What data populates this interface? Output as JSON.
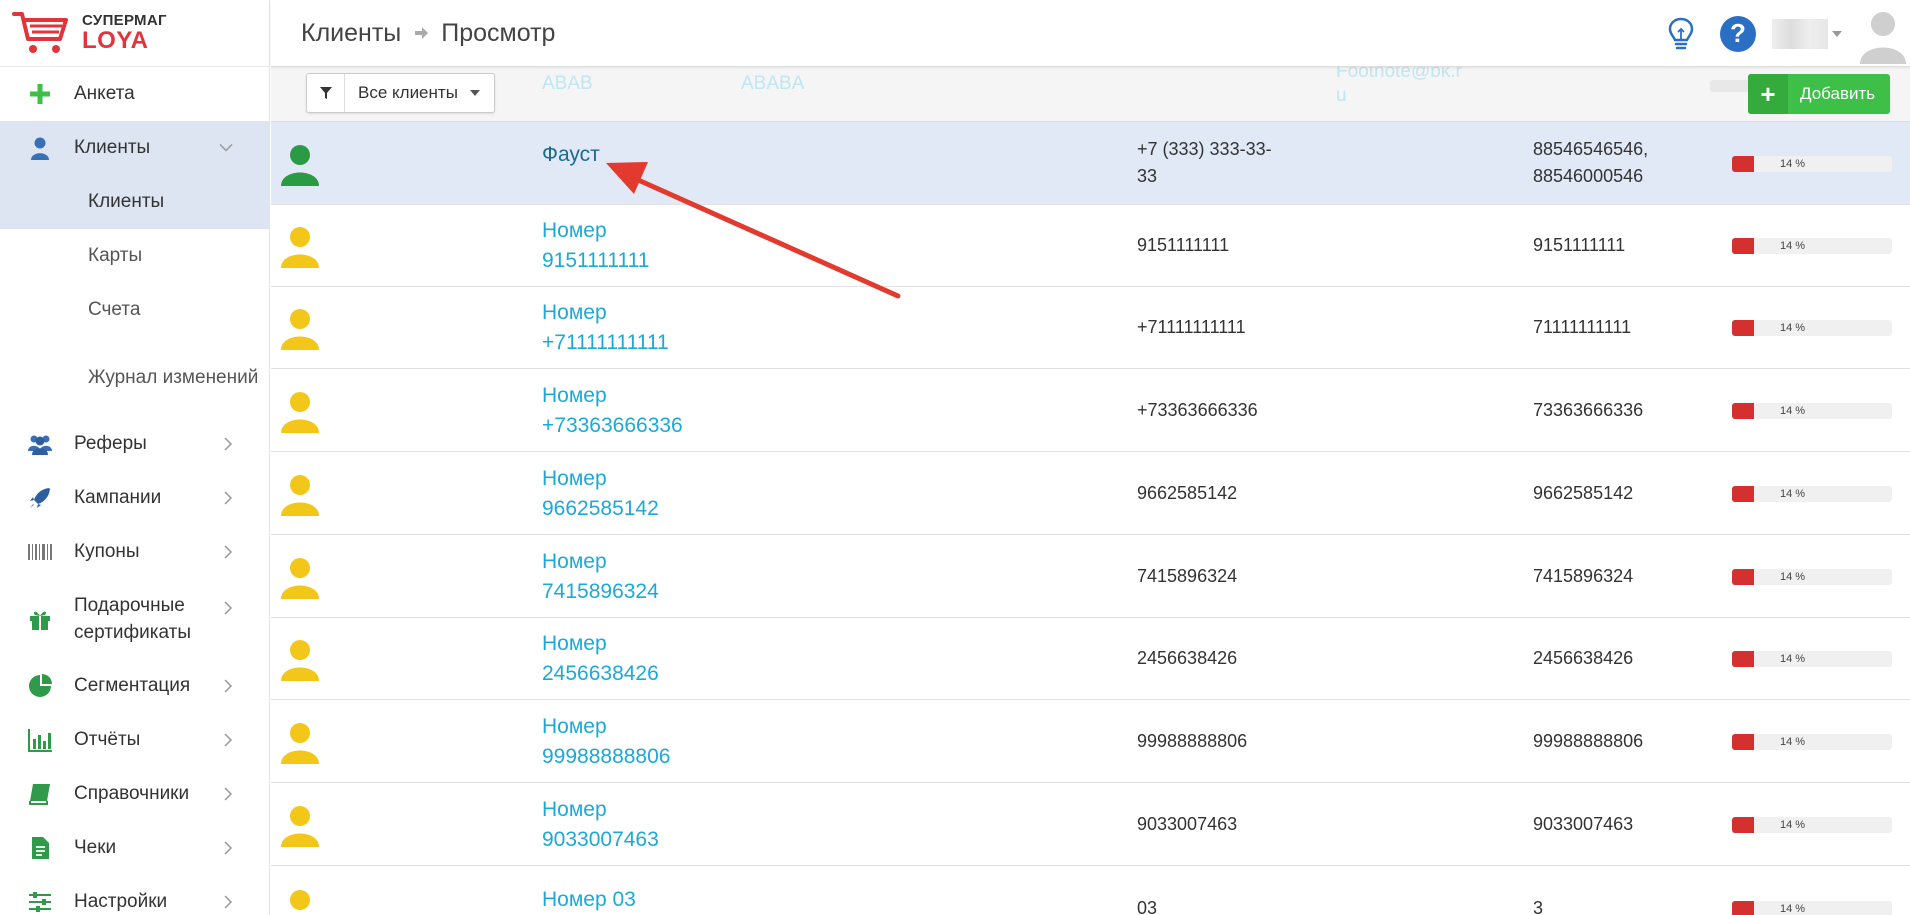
{
  "logo": {
    "line1": "СУПЕРМАГ",
    "line2": "LOYA"
  },
  "sidebar": {
    "items": [
      {
        "label": "Анкета"
      },
      {
        "label": "Клиенты"
      },
      {
        "label": "Реферы"
      },
      {
        "label": "Кампании"
      },
      {
        "label": "Купоны"
      },
      {
        "label": "Подарочные сертификаты"
      },
      {
        "label": "Сегментация"
      },
      {
        "label": "Отчёты"
      },
      {
        "label": "Справочники"
      },
      {
        "label": "Чеки"
      },
      {
        "label": "Настройки"
      }
    ],
    "sub_items": [
      {
        "label": "Клиенты"
      },
      {
        "label": "Карты"
      },
      {
        "label": "Счета"
      },
      {
        "label": "Журнал изменений"
      }
    ]
  },
  "header": {
    "breadcrumb_root": "Клиенты",
    "breadcrumb_current": "Просмотр",
    "help_label": "?"
  },
  "toolbar": {
    "filter_value": "Все клиенты",
    "add_label": "Добавить",
    "add_symbol": "+",
    "ghost_col1": "ABAB",
    "ghost_col2": "ABABA",
    "ghost_col3": "Footnote@bk.r",
    "ghost_col4": "u"
  },
  "colors": {
    "accent": "#1ca9d8",
    "green": "#3ebf48",
    "red": "#d4302f",
    "selected_row": "#e1e8f6"
  },
  "rows": [
    {
      "name1": "Фауст",
      "name2": "",
      "phone1": "+7 (333) 333-33-",
      "phone2": "33",
      "card1": "88546546546,",
      "card2": "88546000546",
      "progress": "14 %",
      "progress_value": 14,
      "avatar": "green"
    },
    {
      "name1": "Номер",
      "name2": "9151111111",
      "phone1": "9151111111",
      "phone2": "",
      "card1": "9151111111",
      "card2": "",
      "progress": "14 %",
      "progress_value": 14,
      "avatar": "yellow"
    },
    {
      "name1": "Номер",
      "name2": "+71111111111",
      "phone1": "+71111111111",
      "phone2": "",
      "card1": "71111111111",
      "card2": "",
      "progress": "14 %",
      "progress_value": 14,
      "avatar": "yellow"
    },
    {
      "name1": "Номер",
      "name2": "+73363666336",
      "phone1": "+73363666336",
      "phone2": "",
      "card1": "73363666336",
      "card2": "",
      "progress": "14 %",
      "progress_value": 14,
      "avatar": "yellow"
    },
    {
      "name1": "Номер",
      "name2": "9662585142",
      "phone1": "9662585142",
      "phone2": "",
      "card1": "9662585142",
      "card2": "",
      "progress": "14 %",
      "progress_value": 14,
      "avatar": "yellow"
    },
    {
      "name1": "Номер",
      "name2": "7415896324",
      "phone1": "7415896324",
      "phone2": "",
      "card1": "7415896324",
      "card2": "",
      "progress": "14 %",
      "progress_value": 14,
      "avatar": "yellow"
    },
    {
      "name1": "Номер",
      "name2": "2456638426",
      "phone1": "2456638426",
      "phone2": "",
      "card1": "2456638426",
      "card2": "",
      "progress": "14 %",
      "progress_value": 14,
      "avatar": "yellow"
    },
    {
      "name1": "Номер",
      "name2": "99988888806",
      "phone1": "99988888806",
      "phone2": "",
      "card1": "99988888806",
      "card2": "",
      "progress": "14 %",
      "progress_value": 14,
      "avatar": "yellow"
    },
    {
      "name1": "Номер",
      "name2": "9033007463",
      "phone1": "9033007463",
      "phone2": "",
      "card1": "9033007463",
      "card2": "",
      "progress": "14 %",
      "progress_value": 14,
      "avatar": "yellow"
    },
    {
      "name1": "Номер 03",
      "name2": "",
      "phone1": "03",
      "phone2": "",
      "card1": "3",
      "card2": "",
      "progress": "14 %",
      "progress_value": 14,
      "avatar": "yellow"
    }
  ]
}
